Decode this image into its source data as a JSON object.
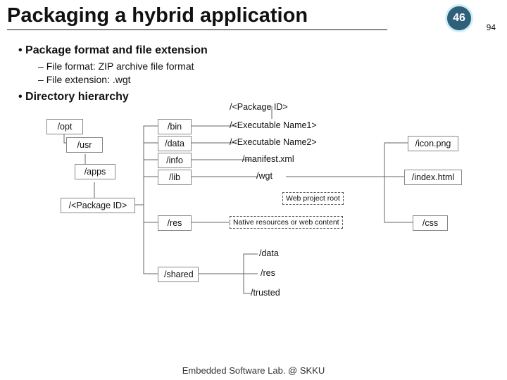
{
  "header": {
    "title": "Packaging a hybrid application",
    "slide_number": "46",
    "total": "94"
  },
  "bullets": {
    "pkg": "Package format and file extension",
    "pkg_sub1": "File format: ZIP archive file format",
    "pkg_sub2": "File extension: .wgt",
    "dir": "Directory hierarchy"
  },
  "nodes": {
    "opt": "/opt",
    "usr": "/usr",
    "apps": "/apps",
    "pkgid": "/<Package ID>",
    "bin": "/bin",
    "data": "/data",
    "info": "/info",
    "lib": "/lib",
    "res": "/res",
    "shared": "/shared",
    "pkgid_lbl": "/<Package ID>",
    "exe1": "/<Executable Name1>",
    "exe2": "/<Executable Name2>",
    "manifest": "/manifest.xml",
    "wgt": "/wgt",
    "webroot": "Web project root",
    "native": "Native resources or web content",
    "data2": "/data",
    "res2": "/res",
    "trusted": "/trusted",
    "icon": "/icon.png",
    "index": "/index.html",
    "css": "/css"
  },
  "footer": "Embedded Software Lab. @ SKKU"
}
